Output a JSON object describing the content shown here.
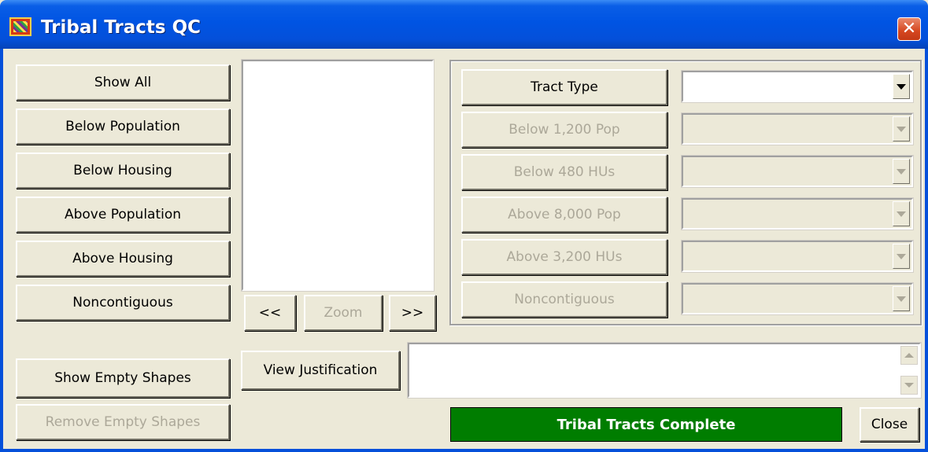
{
  "window": {
    "title": "Tribal Tracts QC",
    "close_glyph": "✕"
  },
  "left_buttons": {
    "show_all": "Show All",
    "below_population": "Below Population",
    "below_housing": "Below Housing",
    "above_population": "Above Population",
    "above_housing": "Above Housing",
    "noncontiguous": "Noncontiguous",
    "show_empty_shapes": "Show Empty Shapes",
    "remove_empty_shapes": "Remove Empty Shapes"
  },
  "nav": {
    "prev": "<<",
    "zoom": "Zoom",
    "next": ">>"
  },
  "tract_panel": {
    "tract_type": "Tract Type",
    "below_pop": "Below 1,200 Pop",
    "below_hus": "Below 480 HUs",
    "above_pop": "Above 8,000 Pop",
    "above_hus": "Above 3,200 HUs",
    "noncontiguous": "Noncontiguous"
  },
  "bottom": {
    "view_justification": "View Justification",
    "complete": "Tribal Tracts Complete",
    "close": "Close"
  },
  "colors": {
    "title_bar": "#0054e3",
    "complete_button": "#007d00",
    "face": "#ece9d8"
  },
  "icons": [
    "app-icon",
    "close-icon",
    "dropdown-arrow-icon",
    "scroll-up-icon",
    "scroll-down-icon"
  ]
}
